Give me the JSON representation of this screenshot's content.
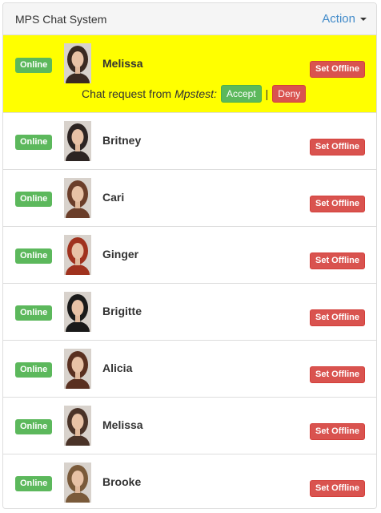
{
  "panel": {
    "title": "MPS Chat System",
    "action_label": "Action"
  },
  "chat_request": {
    "prefix": "Chat request from",
    "from": "Mpstest:",
    "accept_label": "Accept",
    "separator": "|",
    "deny_label": "Deny"
  },
  "users": [
    {
      "name": "Melissa",
      "status": "Online",
      "action": "Set Offline",
      "avatar_tone": "#3a2a22",
      "highlight": true
    },
    {
      "name": "Britney",
      "status": "Online",
      "action": "Set Offline",
      "avatar_tone": "#2c2422"
    },
    {
      "name": "Cari",
      "status": "Online",
      "action": "Set Offline",
      "avatar_tone": "#6b3e2a"
    },
    {
      "name": "Ginger",
      "status": "Online",
      "action": "Set Offline",
      "avatar_tone": "#a0321e"
    },
    {
      "name": "Brigitte",
      "status": "Online",
      "action": "Set Offline",
      "avatar_tone": "#1a1a1a"
    },
    {
      "name": "Alicia",
      "status": "Online",
      "action": "Set Offline",
      "avatar_tone": "#5a3020"
    },
    {
      "name": "Melissa",
      "status": "Online",
      "action": "Set Offline",
      "avatar_tone": "#4a3328"
    },
    {
      "name": "Brooke",
      "status": "Online",
      "action": "Set Offline",
      "avatar_tone": "#7a5a3a"
    }
  ],
  "colors": {
    "online": "#5cb85c",
    "offline": "#d9534f",
    "highlight": "#ffff00",
    "link": "#428bca"
  }
}
